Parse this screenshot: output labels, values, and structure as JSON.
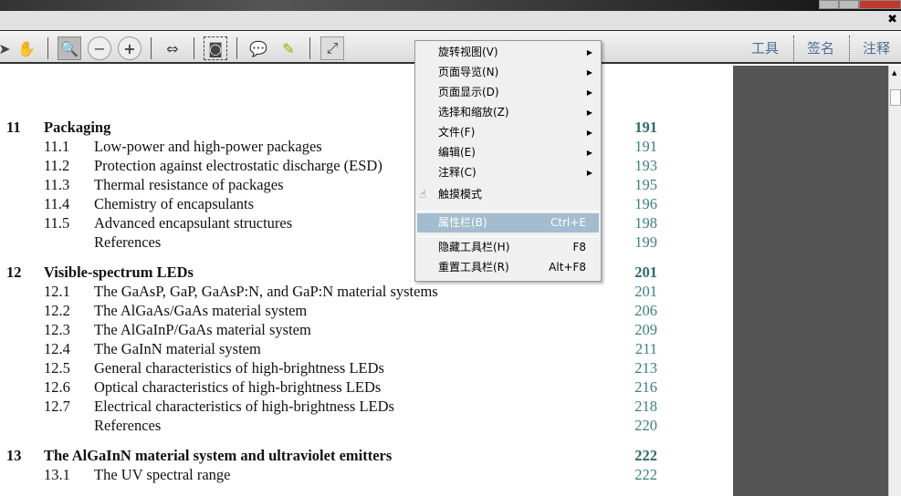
{
  "window": {
    "doc_close": "✖"
  },
  "toolbar": {
    "right": [
      "工具",
      "签名",
      "注释"
    ]
  },
  "toc": [
    {
      "type": "ch",
      "num": "11",
      "title": "Packaging",
      "page": "191"
    },
    {
      "type": "sec",
      "num": "11.1",
      "title": "Low-power and high-power packages",
      "page": "191"
    },
    {
      "type": "sec",
      "num": "11.2",
      "title": "Protection against electrostatic discharge (ESD)",
      "page": "193"
    },
    {
      "type": "sec",
      "num": "11.3",
      "title": "Thermal resistance of packages",
      "page": "195"
    },
    {
      "type": "sec",
      "num": "11.4",
      "title": "Chemistry of encapsulants",
      "page": "196"
    },
    {
      "type": "sec",
      "num": "11.5",
      "title": "Advanced encapsulant structures",
      "page": "198"
    },
    {
      "type": "sec",
      "num": "",
      "title": "References",
      "page": "199"
    },
    {
      "type": "ch",
      "num": "12",
      "title": "Visible-spectrum LEDs",
      "page": "201"
    },
    {
      "type": "sec",
      "num": "12.1",
      "title": "The GaAsP, GaP, GaAsP:N, and GaP:N material systems",
      "page": "201"
    },
    {
      "type": "sec",
      "num": "12.2",
      "title": "The AlGaAs/GaAs material system",
      "page": "206"
    },
    {
      "type": "sec",
      "num": "12.3",
      "title": "The AlGaInP/GaAs material system",
      "page": "209"
    },
    {
      "type": "sec",
      "num": "12.4",
      "title": "The GaInN material system",
      "page": "211"
    },
    {
      "type": "sec",
      "num": "12.5",
      "title": "General characteristics of high-brightness LEDs",
      "page": "213"
    },
    {
      "type": "sec",
      "num": "12.6",
      "title": "Optical characteristics of high-brightness LEDs",
      "page": "216"
    },
    {
      "type": "sec",
      "num": "12.7",
      "title": "Electrical characteristics of high-brightness LEDs",
      "page": "218"
    },
    {
      "type": "sec",
      "num": "",
      "title": "References",
      "page": "220"
    },
    {
      "type": "ch",
      "num": "13",
      "title": "The AlGaInN material system and ultraviolet emitters",
      "page": "222"
    },
    {
      "type": "sec",
      "num": "13.1",
      "title": "The UV spectral range",
      "page": "222"
    }
  ],
  "menu": {
    "items": [
      {
        "label": "旋转视图(V)",
        "sub": true
      },
      {
        "label": "页面导览(N)",
        "sub": true
      },
      {
        "label": "页面显示(D)",
        "sub": true
      },
      {
        "label": "选择和缩放(Z)",
        "sub": true
      },
      {
        "label": "文件(F)",
        "sub": true
      },
      {
        "label": "编辑(E)",
        "sub": true
      },
      {
        "label": "注释(C)",
        "sub": true
      }
    ],
    "touch": "触摸模式",
    "properties": {
      "label": "属性栏(B)",
      "key": "Ctrl+E"
    },
    "hide": {
      "label": "隐藏工具栏(H)",
      "key": "F8"
    },
    "reset": {
      "label": "重置工具栏(R)",
      "key": "Alt+F8"
    }
  }
}
